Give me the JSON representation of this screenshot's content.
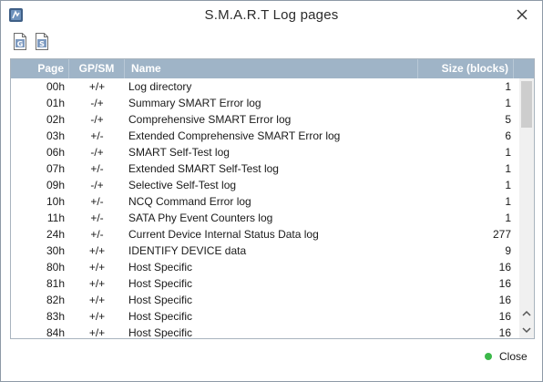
{
  "window": {
    "title": "S.M.A.R.T Log pages",
    "icon": "app-icon",
    "close_icon": "close-icon"
  },
  "toolbar": {
    "buttons": [
      {
        "icon": "generic-log-icon",
        "letter": "G"
      },
      {
        "icon": "smart-log-icon",
        "letter": "S"
      }
    ]
  },
  "table": {
    "columns": [
      "Page",
      "GP/SM",
      "Name",
      "Size (blocks)"
    ],
    "rows": [
      {
        "page": "00h",
        "gpsm": "+/+",
        "name": "Log directory",
        "size": "1"
      },
      {
        "page": "01h",
        "gpsm": "-/+",
        "name": "Summary SMART Error log",
        "size": "1"
      },
      {
        "page": "02h",
        "gpsm": "-/+",
        "name": "Comprehensive SMART Error log",
        "size": "5"
      },
      {
        "page": "03h",
        "gpsm": "+/-",
        "name": "Extended Comprehensive SMART Error log",
        "size": "6"
      },
      {
        "page": "06h",
        "gpsm": "-/+",
        "name": "SMART Self-Test log",
        "size": "1"
      },
      {
        "page": "07h",
        "gpsm": "+/-",
        "name": "Extended SMART Self-Test log",
        "size": "1"
      },
      {
        "page": "09h",
        "gpsm": "-/+",
        "name": "Selective Self-Test log",
        "size": "1"
      },
      {
        "page": "10h",
        "gpsm": "+/-",
        "name": "NCQ Command Error log",
        "size": "1"
      },
      {
        "page": "11h",
        "gpsm": "+/-",
        "name": "SATA Phy Event Counters log",
        "size": "1"
      },
      {
        "page": "24h",
        "gpsm": "+/-",
        "name": "Current Device Internal Status Data log",
        "size": "277"
      },
      {
        "page": "30h",
        "gpsm": "+/+",
        "name": "IDENTIFY DEVICE data",
        "size": "9"
      },
      {
        "page": "80h",
        "gpsm": "+/+",
        "name": "Host Specific",
        "size": "16"
      },
      {
        "page": "81h",
        "gpsm": "+/+",
        "name": "Host Specific",
        "size": "16"
      },
      {
        "page": "82h",
        "gpsm": "+/+",
        "name": "Host Specific",
        "size": "16"
      },
      {
        "page": "83h",
        "gpsm": "+/+",
        "name": "Host Specific",
        "size": "16"
      },
      {
        "page": "84h",
        "gpsm": "+/+",
        "name": "Host Specific",
        "size": "16"
      }
    ]
  },
  "footer": {
    "close_label": "Close",
    "status_color": "#3cb84a"
  },
  "colors": {
    "header_bg": "#9fb4c7",
    "header_text": "#ffffff"
  }
}
